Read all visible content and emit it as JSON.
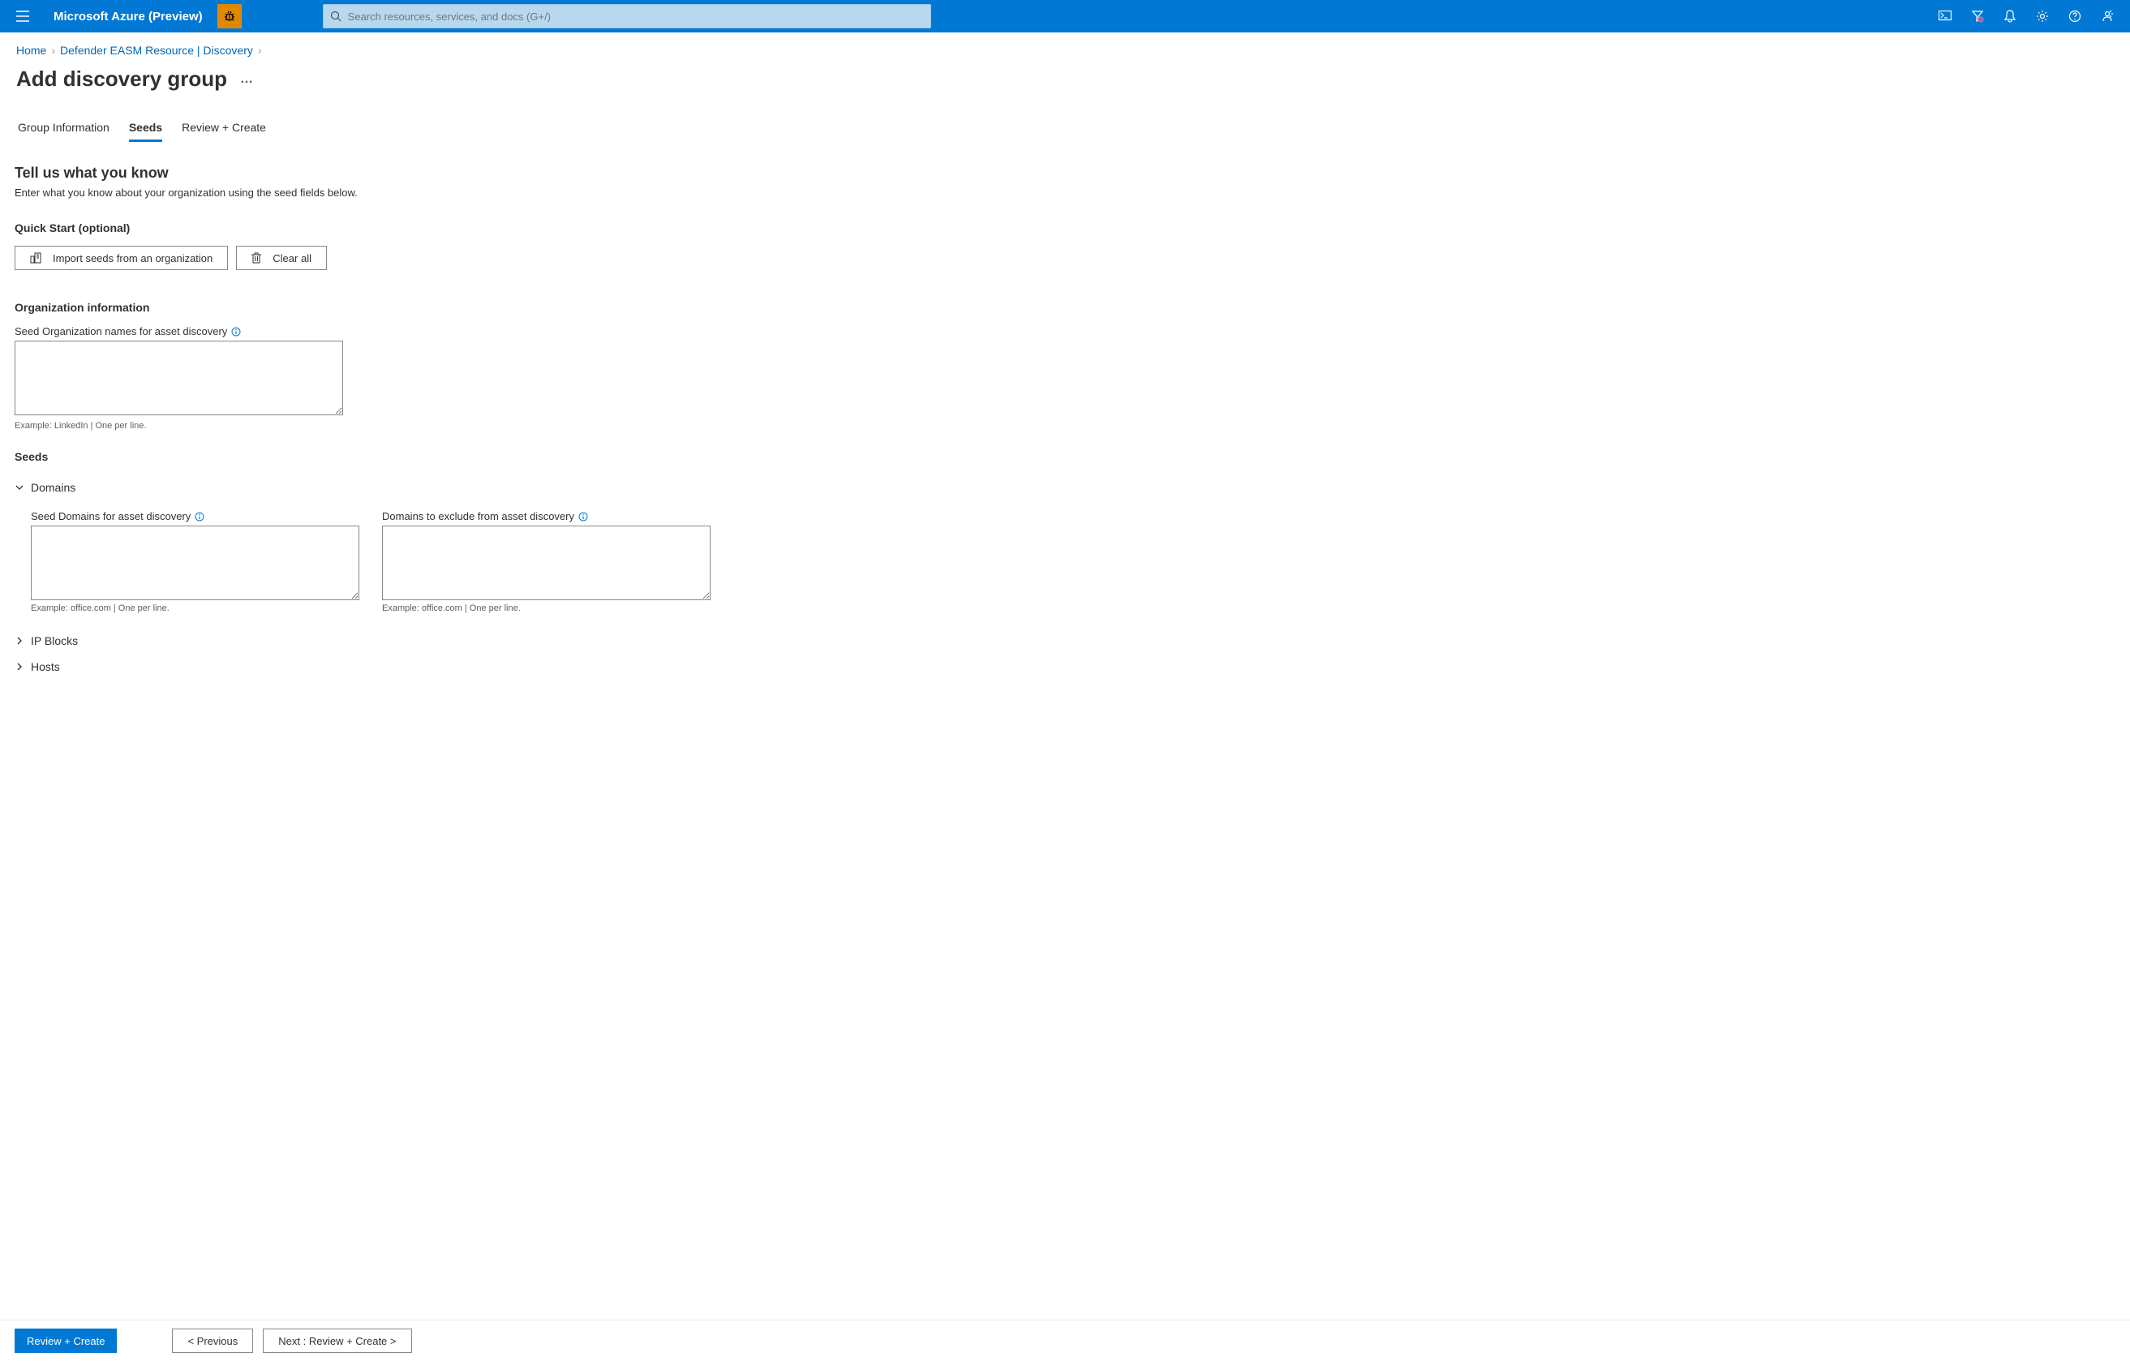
{
  "header": {
    "brand": "Microsoft Azure (Preview)",
    "search_placeholder": "Search resources, services, and docs (G+/)"
  },
  "breadcrumb": {
    "home": "Home",
    "resource": "Defender EASM Resource | Discovery"
  },
  "page_title": "Add discovery group",
  "tabs": {
    "group_info": "Group Information",
    "seeds": "Seeds",
    "review": "Review + Create"
  },
  "intro": {
    "title": "Tell us what you know",
    "desc": "Enter what you know about your organization using the seed fields below."
  },
  "quick_start": {
    "title": "Quick Start (optional)",
    "import_btn": "Import seeds from an organization",
    "clear_btn": "Clear all"
  },
  "org_info": {
    "title": "Organization information",
    "label": "Seed Organization names for asset discovery",
    "hint": "Example: LinkedIn | One per line."
  },
  "seeds": {
    "title": "Seeds",
    "domains": {
      "label": "Domains",
      "seed_label": "Seed Domains for asset discovery",
      "seed_hint": "Example: office.com | One per line.",
      "exclude_label": "Domains to exclude from asset discovery",
      "exclude_hint": "Example: office.com | One per line."
    },
    "ip_blocks": {
      "label": "IP Blocks"
    },
    "hosts": {
      "label": "Hosts"
    }
  },
  "footer": {
    "review": "Review + Create",
    "previous": "< Previous",
    "next": "Next : Review + Create >"
  }
}
